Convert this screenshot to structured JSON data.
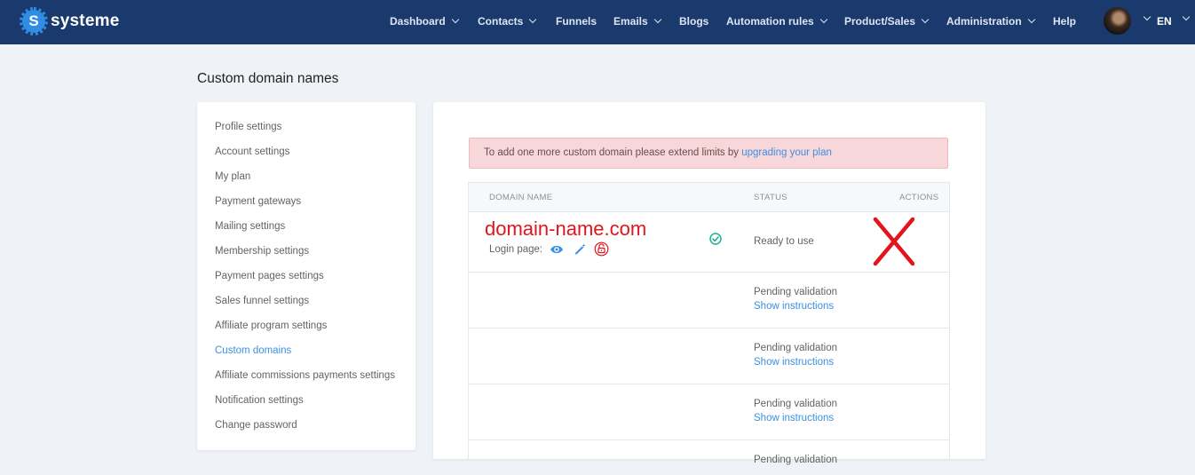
{
  "brand": {
    "name": "systeme",
    "logo_letter": "S"
  },
  "nav": {
    "items": [
      {
        "label": "Dashboard",
        "dropdown": true
      },
      {
        "label": "Contacts",
        "dropdown": true
      },
      {
        "label": "Funnels",
        "dropdown": false
      },
      {
        "label": "Emails",
        "dropdown": true
      },
      {
        "label": "Blogs",
        "dropdown": false
      },
      {
        "label": "Automation rules",
        "dropdown": true
      },
      {
        "label": "Product/Sales",
        "dropdown": true
      },
      {
        "label": "Administration",
        "dropdown": true
      },
      {
        "label": "Help",
        "dropdown": false
      }
    ],
    "language": "EN"
  },
  "page_title": "Custom domain names",
  "sidebar": {
    "items": [
      {
        "label": "Profile settings"
      },
      {
        "label": "Account settings"
      },
      {
        "label": "My plan"
      },
      {
        "label": "Payment gateways"
      },
      {
        "label": "Mailing settings"
      },
      {
        "label": "Membership settings"
      },
      {
        "label": "Payment pages settings"
      },
      {
        "label": "Sales funnel settings"
      },
      {
        "label": "Affiliate program settings"
      },
      {
        "label": "Custom domains",
        "active": true
      },
      {
        "label": "Affiliate commissions payments settings"
      },
      {
        "label": "Notification settings"
      },
      {
        "label": "Change password"
      }
    ]
  },
  "alert": {
    "text": "To add one more custom domain please extend limits by ",
    "link": "upgrading your plan"
  },
  "table": {
    "headers": {
      "domain": "DOMAIN NAME",
      "status": "STATUS",
      "actions": "ACTIONS"
    },
    "rows": [
      {
        "domain": "domain-name.com",
        "login_label": "Login page:",
        "status": "Ready to use"
      },
      {
        "status": "Pending validation",
        "instructions": "Show instructions"
      },
      {
        "status": "Pending validation",
        "instructions": "Show instructions"
      },
      {
        "status": "Pending validation",
        "instructions": "Show instructions"
      },
      {
        "status": "Pending validation"
      }
    ]
  },
  "colors": {
    "navbar": "#1a3a6e",
    "accent": "#3d8fe3",
    "alert_bg": "#f8d7da",
    "annotation_red": "#e3141b",
    "success": "#19b394"
  },
  "icons": [
    "eye-icon",
    "magic-wand-icon",
    "unlock-icon",
    "check-circle-icon",
    "red-x-annotation"
  ]
}
